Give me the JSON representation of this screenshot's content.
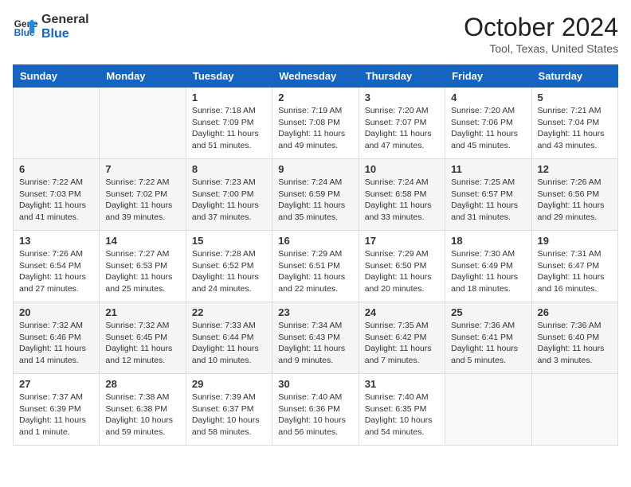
{
  "header": {
    "logo_line1": "General",
    "logo_line2": "Blue",
    "month_title": "October 2024",
    "location": "Tool, Texas, United States"
  },
  "weekdays": [
    "Sunday",
    "Monday",
    "Tuesday",
    "Wednesday",
    "Thursday",
    "Friday",
    "Saturday"
  ],
  "weeks": [
    [
      {
        "day": "",
        "content": ""
      },
      {
        "day": "",
        "content": ""
      },
      {
        "day": "1",
        "content": "Sunrise: 7:18 AM\nSunset: 7:09 PM\nDaylight: 11 hours and 51 minutes."
      },
      {
        "day": "2",
        "content": "Sunrise: 7:19 AM\nSunset: 7:08 PM\nDaylight: 11 hours and 49 minutes."
      },
      {
        "day": "3",
        "content": "Sunrise: 7:20 AM\nSunset: 7:07 PM\nDaylight: 11 hours and 47 minutes."
      },
      {
        "day": "4",
        "content": "Sunrise: 7:20 AM\nSunset: 7:06 PM\nDaylight: 11 hours and 45 minutes."
      },
      {
        "day": "5",
        "content": "Sunrise: 7:21 AM\nSunset: 7:04 PM\nDaylight: 11 hours and 43 minutes."
      }
    ],
    [
      {
        "day": "6",
        "content": "Sunrise: 7:22 AM\nSunset: 7:03 PM\nDaylight: 11 hours and 41 minutes."
      },
      {
        "day": "7",
        "content": "Sunrise: 7:22 AM\nSunset: 7:02 PM\nDaylight: 11 hours and 39 minutes."
      },
      {
        "day": "8",
        "content": "Sunrise: 7:23 AM\nSunset: 7:00 PM\nDaylight: 11 hours and 37 minutes."
      },
      {
        "day": "9",
        "content": "Sunrise: 7:24 AM\nSunset: 6:59 PM\nDaylight: 11 hours and 35 minutes."
      },
      {
        "day": "10",
        "content": "Sunrise: 7:24 AM\nSunset: 6:58 PM\nDaylight: 11 hours and 33 minutes."
      },
      {
        "day": "11",
        "content": "Sunrise: 7:25 AM\nSunset: 6:57 PM\nDaylight: 11 hours and 31 minutes."
      },
      {
        "day": "12",
        "content": "Sunrise: 7:26 AM\nSunset: 6:56 PM\nDaylight: 11 hours and 29 minutes."
      }
    ],
    [
      {
        "day": "13",
        "content": "Sunrise: 7:26 AM\nSunset: 6:54 PM\nDaylight: 11 hours and 27 minutes."
      },
      {
        "day": "14",
        "content": "Sunrise: 7:27 AM\nSunset: 6:53 PM\nDaylight: 11 hours and 25 minutes."
      },
      {
        "day": "15",
        "content": "Sunrise: 7:28 AM\nSunset: 6:52 PM\nDaylight: 11 hours and 24 minutes."
      },
      {
        "day": "16",
        "content": "Sunrise: 7:29 AM\nSunset: 6:51 PM\nDaylight: 11 hours and 22 minutes."
      },
      {
        "day": "17",
        "content": "Sunrise: 7:29 AM\nSunset: 6:50 PM\nDaylight: 11 hours and 20 minutes."
      },
      {
        "day": "18",
        "content": "Sunrise: 7:30 AM\nSunset: 6:49 PM\nDaylight: 11 hours and 18 minutes."
      },
      {
        "day": "19",
        "content": "Sunrise: 7:31 AM\nSunset: 6:47 PM\nDaylight: 11 hours and 16 minutes."
      }
    ],
    [
      {
        "day": "20",
        "content": "Sunrise: 7:32 AM\nSunset: 6:46 PM\nDaylight: 11 hours and 14 minutes."
      },
      {
        "day": "21",
        "content": "Sunrise: 7:32 AM\nSunset: 6:45 PM\nDaylight: 11 hours and 12 minutes."
      },
      {
        "day": "22",
        "content": "Sunrise: 7:33 AM\nSunset: 6:44 PM\nDaylight: 11 hours and 10 minutes."
      },
      {
        "day": "23",
        "content": "Sunrise: 7:34 AM\nSunset: 6:43 PM\nDaylight: 11 hours and 9 minutes."
      },
      {
        "day": "24",
        "content": "Sunrise: 7:35 AM\nSunset: 6:42 PM\nDaylight: 11 hours and 7 minutes."
      },
      {
        "day": "25",
        "content": "Sunrise: 7:36 AM\nSunset: 6:41 PM\nDaylight: 11 hours and 5 minutes."
      },
      {
        "day": "26",
        "content": "Sunrise: 7:36 AM\nSunset: 6:40 PM\nDaylight: 11 hours and 3 minutes."
      }
    ],
    [
      {
        "day": "27",
        "content": "Sunrise: 7:37 AM\nSunset: 6:39 PM\nDaylight: 11 hours and 1 minute."
      },
      {
        "day": "28",
        "content": "Sunrise: 7:38 AM\nSunset: 6:38 PM\nDaylight: 10 hours and 59 minutes."
      },
      {
        "day": "29",
        "content": "Sunrise: 7:39 AM\nSunset: 6:37 PM\nDaylight: 10 hours and 58 minutes."
      },
      {
        "day": "30",
        "content": "Sunrise: 7:40 AM\nSunset: 6:36 PM\nDaylight: 10 hours and 56 minutes."
      },
      {
        "day": "31",
        "content": "Sunrise: 7:40 AM\nSunset: 6:35 PM\nDaylight: 10 hours and 54 minutes."
      },
      {
        "day": "",
        "content": ""
      },
      {
        "day": "",
        "content": ""
      }
    ]
  ]
}
